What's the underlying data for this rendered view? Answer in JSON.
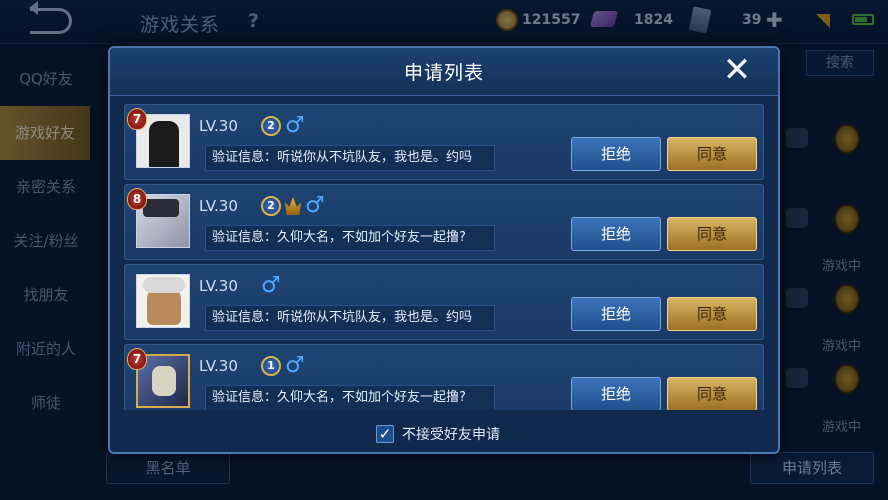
{
  "topbar": {
    "title": "游戏关系",
    "help": "?",
    "coins": "121557",
    "gems": "1824",
    "tickets": "39",
    "plus": "✚"
  },
  "sidebar": {
    "items": [
      {
        "label": "QQ好友"
      },
      {
        "label": "游戏好友",
        "active": true
      },
      {
        "label": "亲密关系"
      },
      {
        "label": "关注/粉丝"
      },
      {
        "label": "找朋友"
      },
      {
        "label": "附近的人"
      },
      {
        "label": "师徒"
      }
    ]
  },
  "right_panel": {
    "search_label": "搜索",
    "statuses": [
      "游戏中",
      "游戏中",
      "游戏中"
    ]
  },
  "bottom": {
    "blacklist_label": "黑名单",
    "request_list_label": "申请列表"
  },
  "dialog": {
    "title": "申请列表",
    "close_glyph": "✕",
    "reject_label": "拒绝",
    "accept_label": "同意",
    "requests": [
      {
        "rank": "7",
        "level": "LV.30",
        "tier": "2",
        "crown": false,
        "message": "验证信息：听说你从不坑队友，我也是。约吗",
        "avatar_color": "#e9e9e9"
      },
      {
        "rank": "8",
        "level": "LV.30",
        "tier": "2",
        "crown": true,
        "message": "验证信息：久仰大名，不如加个好友一起撸?",
        "avatar_color": "#c7c9d6"
      },
      {
        "rank": "",
        "level": "LV.30",
        "tier": "",
        "crown": false,
        "message": "验证信息：听说你从不坑队友，我也是。约吗",
        "avatar_color": "#f2f0ea"
      },
      {
        "rank": "7",
        "level": "LV.30",
        "tier": "1",
        "crown": false,
        "message": "验证信息：久仰大名，不如加个好友一起撸?",
        "avatar_color": "#3a4a78"
      }
    ],
    "footer_checkbox_label": "不接受好友申请",
    "footer_checked": true
  },
  "colors": {
    "accent_gold": "#d9b465",
    "accent_blue": "#3b73b8",
    "male_icon": "#4fa7ff"
  }
}
